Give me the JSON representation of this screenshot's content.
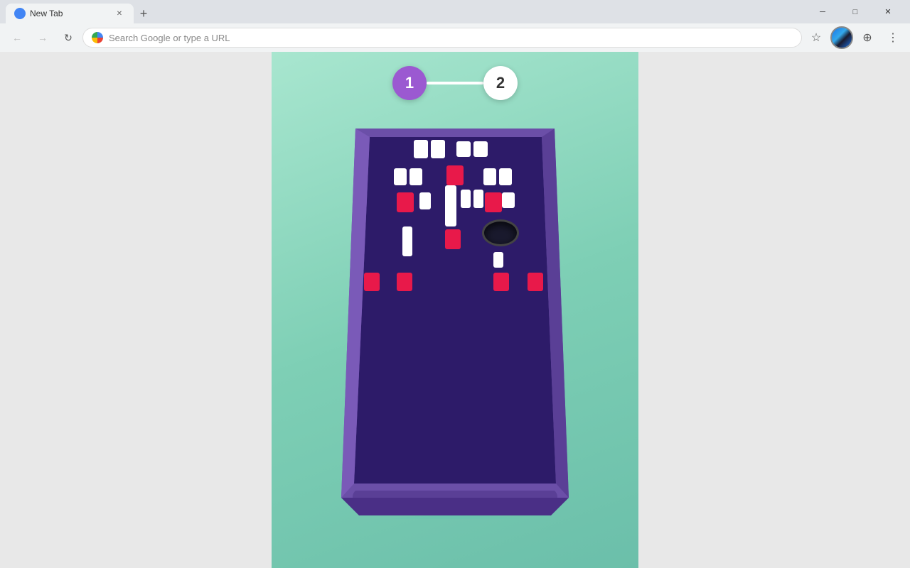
{
  "browser": {
    "tab_title": "New Tab",
    "tab_new_label": "+",
    "address_placeholder": "Search Google or type a URL",
    "window_minimize": "─",
    "window_maximize": "□",
    "window_close": "✕"
  },
  "game": {
    "step1_label": "1",
    "step2_label": "2",
    "step_line": ""
  }
}
